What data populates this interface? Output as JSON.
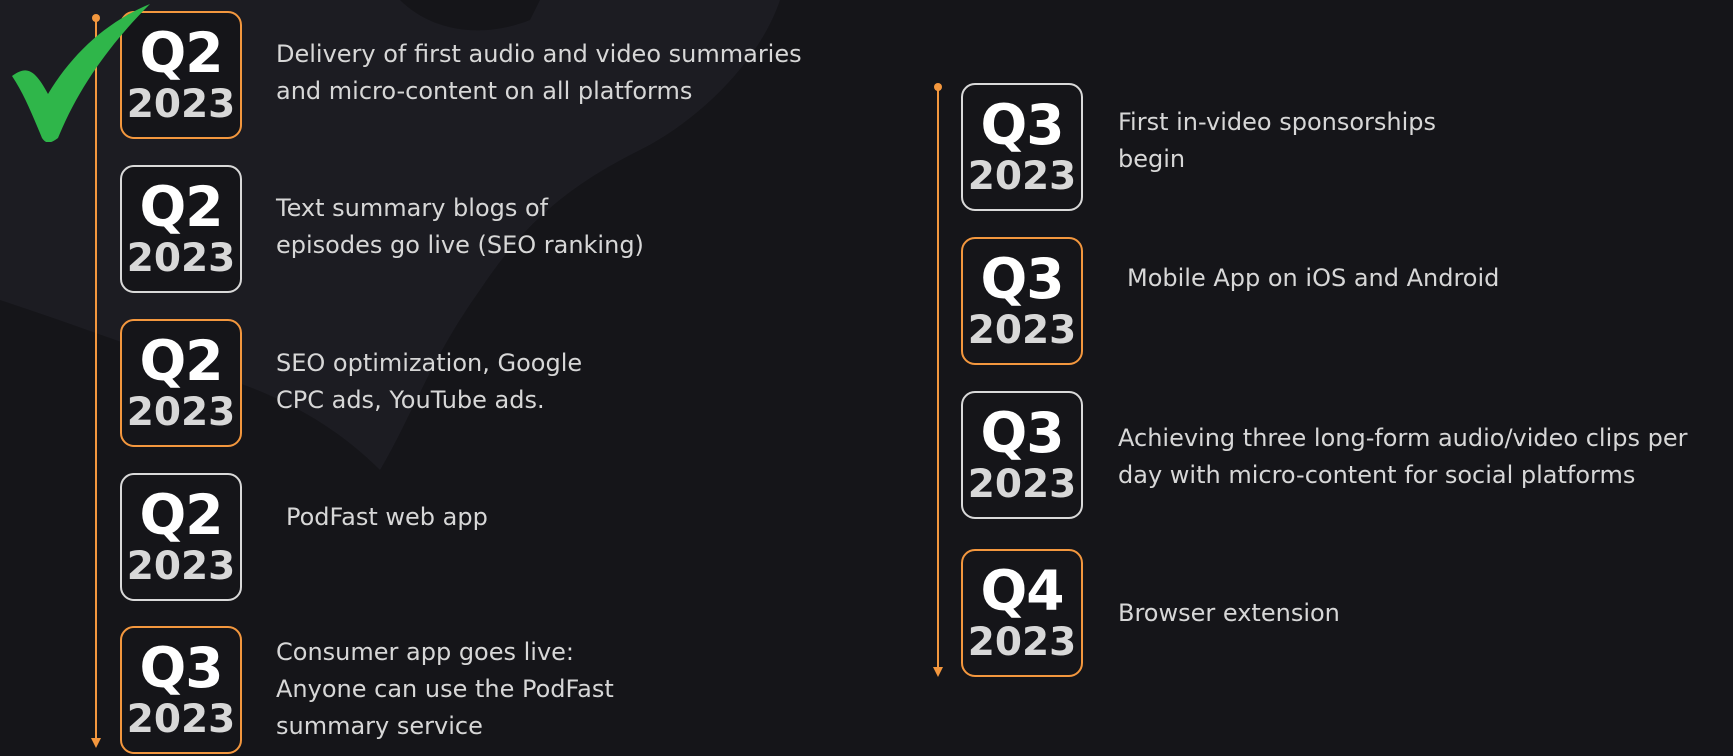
{
  "colors": {
    "background": "#151519",
    "accent_orange": "#f3973e",
    "badge_border_gray": "#d9d9d9",
    "text": "#d7d7d7",
    "check_green": "#2fb64a"
  },
  "left_items": [
    {
      "quarter": "Q2",
      "year": "2023",
      "text": "Delivery of first audio and video summaries\nand micro-content on all platforms",
      "border": "orange",
      "completed": true
    },
    {
      "quarter": "Q2",
      "year": "2023",
      "text": "Text summary blogs of\nepisodes go live (SEO ranking)",
      "border": "gray",
      "completed": false
    },
    {
      "quarter": "Q2",
      "year": "2023",
      "text": "SEO optimization, Google\nCPC ads, YouTube ads.",
      "border": "orange",
      "completed": false
    },
    {
      "quarter": "Q2",
      "year": "2023",
      "text": "PodFast web app",
      "border": "gray",
      "completed": false
    },
    {
      "quarter": "Q3",
      "year": "2023",
      "text": "Consumer app goes live:\nAnyone can use the PodFast\nsummary service",
      "border": "orange",
      "completed": false
    }
  ],
  "right_items": [
    {
      "quarter": "Q3",
      "year": "2023",
      "text": "First in-video sponsorships\nbegin",
      "border": "gray"
    },
    {
      "quarter": "Q3",
      "year": "2023",
      "text": "Mobile App on iOS and Android",
      "border": "orange"
    },
    {
      "quarter": "Q3",
      "year": "2023",
      "text": "Achieving three long-form audio/video clips per\nday with micro-content for social platforms",
      "border": "gray"
    },
    {
      "quarter": "Q4",
      "year": "2023",
      "text": "Browser extension",
      "border": "orange"
    }
  ],
  "icons": {
    "completed_marker": "checkmark-icon"
  }
}
